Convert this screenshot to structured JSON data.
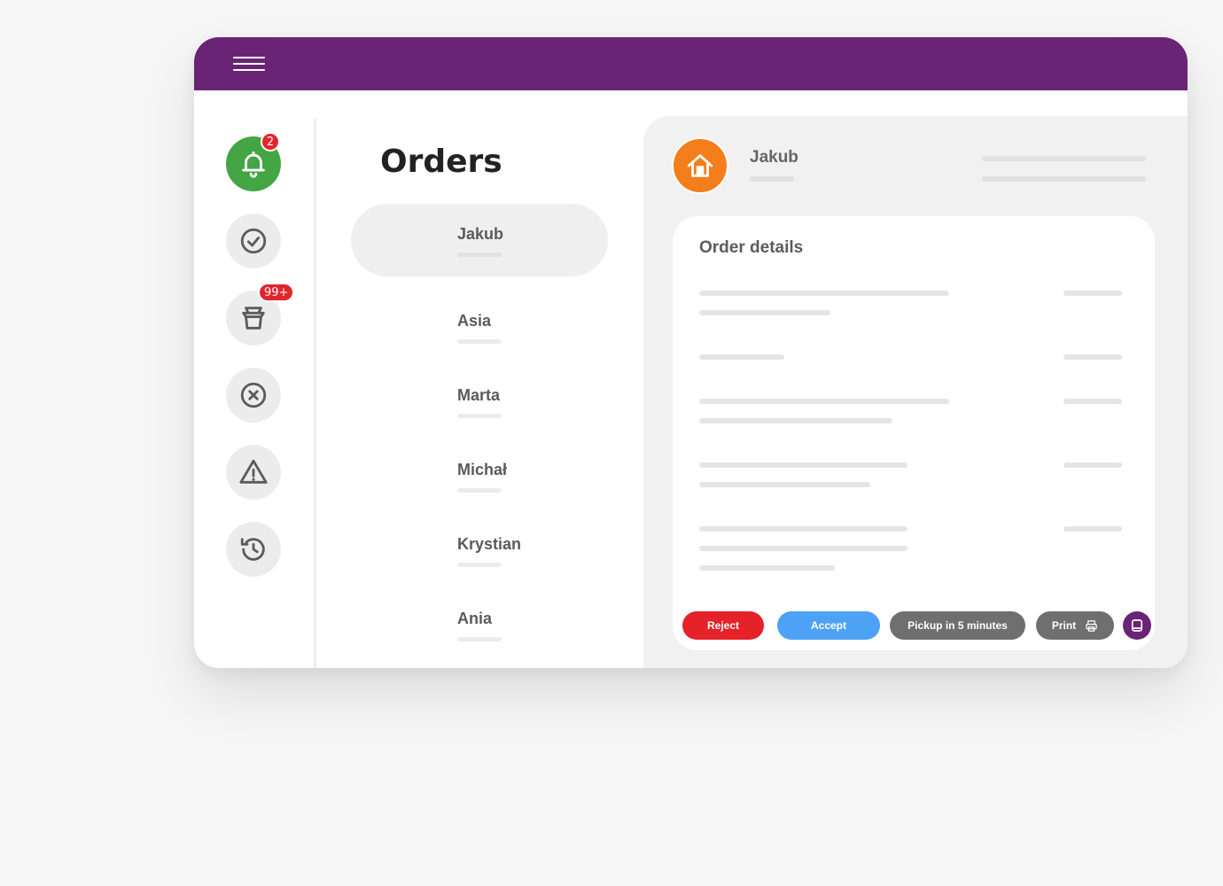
{
  "colors": {
    "topbar": "#6a2476",
    "active_nav": "#43a543",
    "badge": "#e2252b",
    "logo": "#f47e1b",
    "reject": "#e52129",
    "accept": "#4da2f5",
    "neutral_button": "#6f6f6f"
  },
  "topbar": {
    "menu_icon": "hamburger-icon"
  },
  "sidebar": {
    "items": [
      {
        "icon": "bell-icon",
        "badge": "2",
        "active": true
      },
      {
        "icon": "check-circle-icon"
      },
      {
        "icon": "takeaway-box-icon",
        "badge": "99+"
      },
      {
        "icon": "x-circle-icon"
      },
      {
        "icon": "warning-triangle-icon"
      },
      {
        "icon": "history-icon"
      }
    ]
  },
  "orders": {
    "title": "Orders",
    "items": [
      {
        "name": "Jakub",
        "selected": true
      },
      {
        "name": "Asia"
      },
      {
        "name": "Marta"
      },
      {
        "name": "Michał"
      },
      {
        "name": "Krystian"
      },
      {
        "name": "Ania"
      }
    ]
  },
  "detail": {
    "logo_icon": "restaurant-logo-icon",
    "customer_name": "Jakub",
    "card_title": "Order details",
    "actions": {
      "reject": "Reject",
      "accept": "Accept",
      "pickup": "Pickup in 5 minutes",
      "print": "Print",
      "print_icon": "printer-icon",
      "chat_icon": "chat-icon"
    }
  }
}
